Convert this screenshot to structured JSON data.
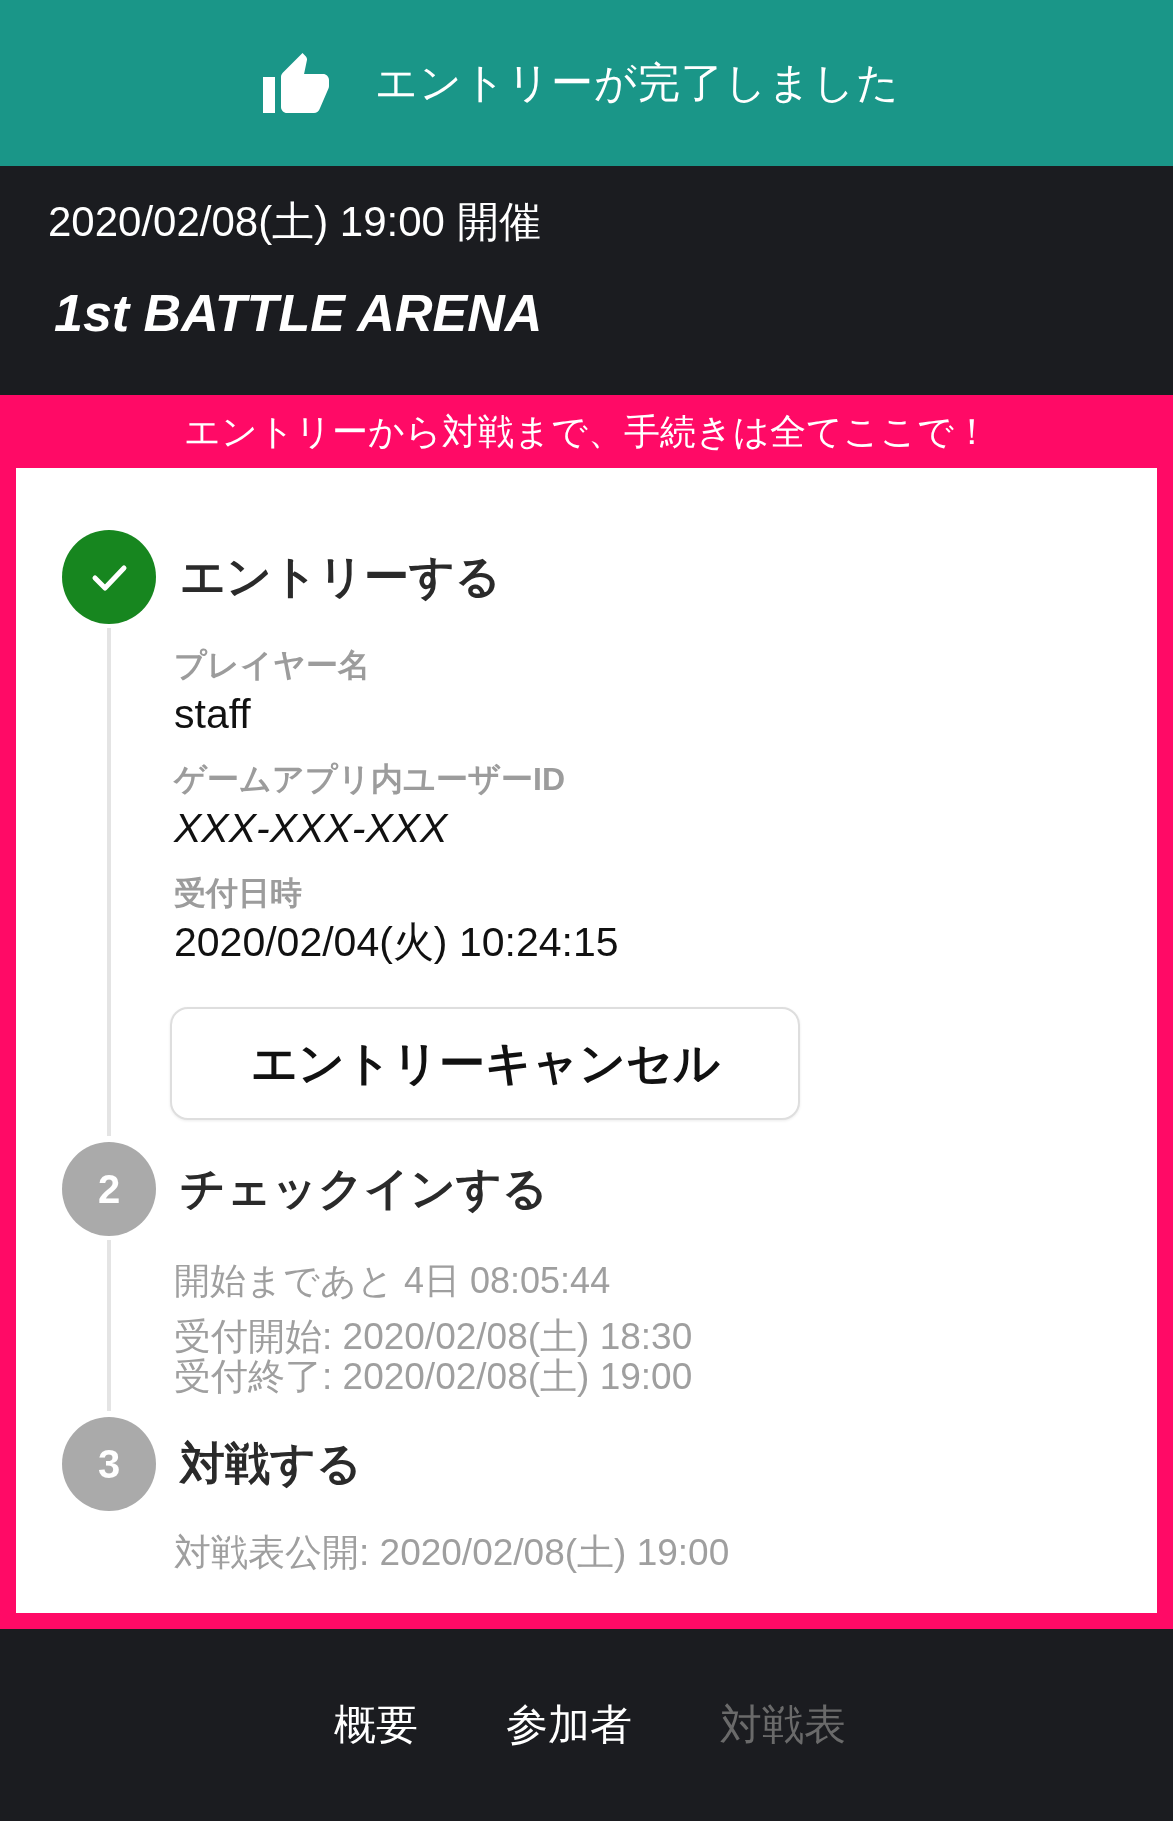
{
  "banner": {
    "message": "エントリーが完了しました"
  },
  "event": {
    "date": "2020/02/08(土) 19:00 開催",
    "title": "1st BATTLE ARENA"
  },
  "tagline": "エントリーから対戦まで、手続きは全てここで！",
  "steps": [
    {
      "title": "エントリーする",
      "completed": true,
      "fields": [
        {
          "label": "プレイヤー名",
          "value": "staff",
          "kind": "plain"
        },
        {
          "label": "ゲームアプリ内ユーザーID",
          "value": "XXX-XXX-XXX",
          "kind": "id"
        },
        {
          "label": "受付日時",
          "value": "2020/02/04(火) 10:24:15",
          "kind": "plain"
        }
      ],
      "button": "エントリーキャンセル"
    },
    {
      "number": "2",
      "title": "チェックインする",
      "completed": false,
      "countdown": "開始まであと 4日 08:05:44",
      "schedule": [
        "受付開始: 2020/02/08(土) 18:30",
        "受付終了: 2020/02/08(土) 19:00"
      ]
    },
    {
      "number": "3",
      "title": "対戦する",
      "completed": false,
      "schedule": [
        "対戦表公開: 2020/02/08(土) 19:00"
      ]
    }
  ],
  "nav": [
    {
      "label": "概要",
      "disabled": false
    },
    {
      "label": "参加者",
      "disabled": false
    },
    {
      "label": "対戦表",
      "disabled": true
    }
  ]
}
